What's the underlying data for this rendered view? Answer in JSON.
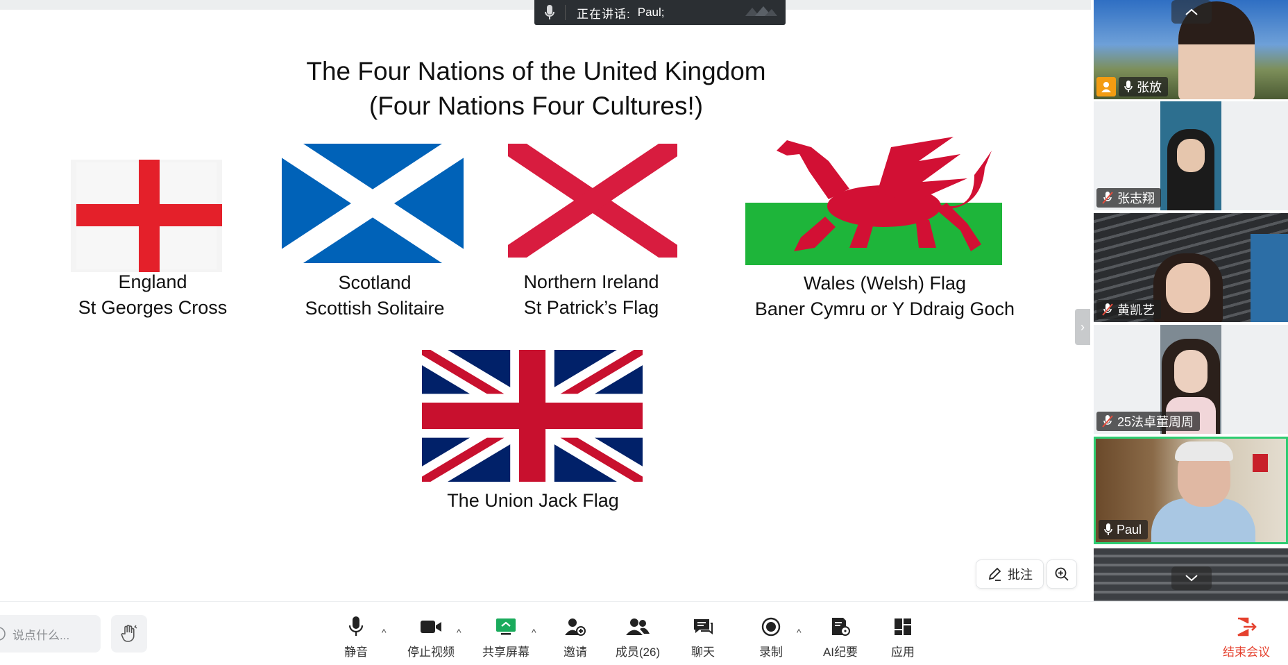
{
  "speaking": {
    "label": "正在讲话:",
    "name": "Paul;"
  },
  "slide": {
    "title_line1": "The Four Nations of the United Kingdom",
    "title_line2": "(Four Nations Four Cultures!)",
    "flags": [
      {
        "line1": "England",
        "line2": "St Georges Cross"
      },
      {
        "line1": "Scotland",
        "line2": "Scottish Solitaire"
      },
      {
        "line1": "Northern Ireland",
        "line2": "St Patrick’s Flag"
      },
      {
        "line1": "Wales (Welsh) Flag",
        "line2": "Baner Cymru or Y Ddraig Goch"
      },
      {
        "line1": "The Union Jack Flag"
      }
    ]
  },
  "overlay": {
    "annotate_label": "批注"
  },
  "participants": [
    {
      "name": "张放",
      "mic": "on",
      "host": true
    },
    {
      "name": "张志翔",
      "mic": "muted"
    },
    {
      "name": "黄凯艺",
      "mic": "muted"
    },
    {
      "name": "25法卓董周周",
      "mic": "muted"
    },
    {
      "name": "Paul",
      "mic": "on",
      "speaking": true
    }
  ],
  "toolbar": {
    "chat_placeholder": "说点什么...",
    "items": [
      {
        "label": "静音",
        "icon": "microphone-icon"
      },
      {
        "label": "停止视频",
        "icon": "video-camera-icon"
      },
      {
        "label": "共享屏幕",
        "icon": "share-screen-icon"
      },
      {
        "label": "邀请",
        "icon": "invite-user-icon"
      },
      {
        "label": "成员(26)",
        "icon": "members-icon"
      },
      {
        "label": "聊天",
        "icon": "chat-icon"
      },
      {
        "label": "录制",
        "icon": "record-icon"
      },
      {
        "label": "AI纪要",
        "icon": "ai-summary-icon"
      },
      {
        "label": "应用",
        "icon": "apps-icon"
      }
    ],
    "end_label": "结束会议"
  },
  "colors": {
    "end_red": "#e5412e",
    "share_green": "#1aab5c",
    "speaking_border": "#2ecc71"
  }
}
